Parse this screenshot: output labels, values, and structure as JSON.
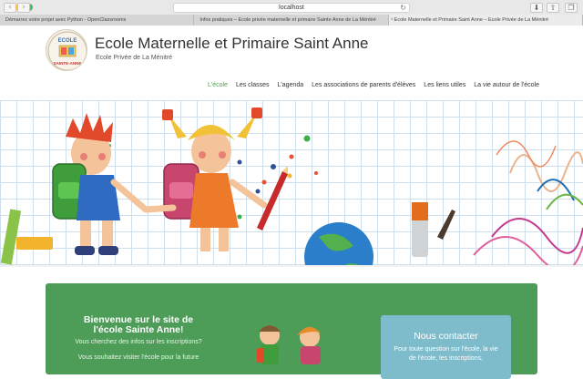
{
  "browser": {
    "address": "localhost",
    "tabs": [
      "Démarrez votre projet avec Python - OpenClassrooms",
      "Infos pratiques – Ecole privée maternelle et primaire Sainte Anne de La Ménitré",
      "Ecole Maternelle et Primaire Saint Anne – Ecole Privée de La Ménitré"
    ]
  },
  "site": {
    "logo_text_top": "ECOLE",
    "logo_text_bottom": "SAINTE-ANNE",
    "title": "Ecole Maternelle et Primaire Saint Anne",
    "subtitle": "Ecole Privée de La Ménitré"
  },
  "menu": [
    "L'école",
    "Les classes",
    "L'agenda",
    "Les associations de parents d'élèves",
    "Les liens utiles",
    "La vie autour de l'école"
  ],
  "welcome": {
    "title": "Bienvenue sur le site de l'école Sainte Anne!",
    "line1": "Vous cherchez des infos sur les inscriptions?",
    "line2": "Vous souhaitez visiter l'école pour la future"
  },
  "contact": {
    "title": "Nous contacter",
    "text": "Pour toute question sur l'école, la vie de l'école, les inscriptions,"
  },
  "colors": {
    "accent": "#4ca24d",
    "panel": "#4d9c57",
    "contact": "#7fbccb"
  }
}
